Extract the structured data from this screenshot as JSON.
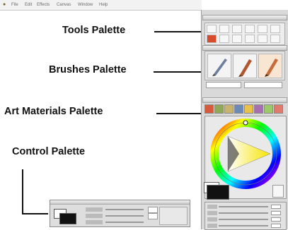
{
  "menubar": {
    "items": [
      "File",
      "Edit",
      "Effects",
      "Canvas",
      "Window",
      "Help"
    ]
  },
  "callouts": {
    "tools": "Tools Palette",
    "brushes": "Brushes Palette",
    "art_materials": "Art Materials Palette",
    "control": "Control Palette"
  },
  "icons": {
    "apple": "apple-menu-icon",
    "tools": [
      "brush-tool-icon",
      "rect-select-icon",
      "lasso-icon",
      "crop-icon",
      "grabber-icon",
      "dropper-icon",
      "eraser-icon",
      "pen-icon",
      "text-icon",
      "magnifier-icon",
      "paint-bucket-icon",
      "arrow-icon"
    ],
    "brushes": [
      "pencil-brush-icon",
      "airbrush-icon",
      "oil-brush-icon"
    ]
  },
  "colors": {
    "background": "#ffffff",
    "panel": "#d9d9d9",
    "callout_text": "#111111",
    "hue_ring_start": "#ff0000",
    "triangle_yellow": "#f6e400",
    "primary_color": "#111111",
    "secondary_color": "#ffffff"
  }
}
